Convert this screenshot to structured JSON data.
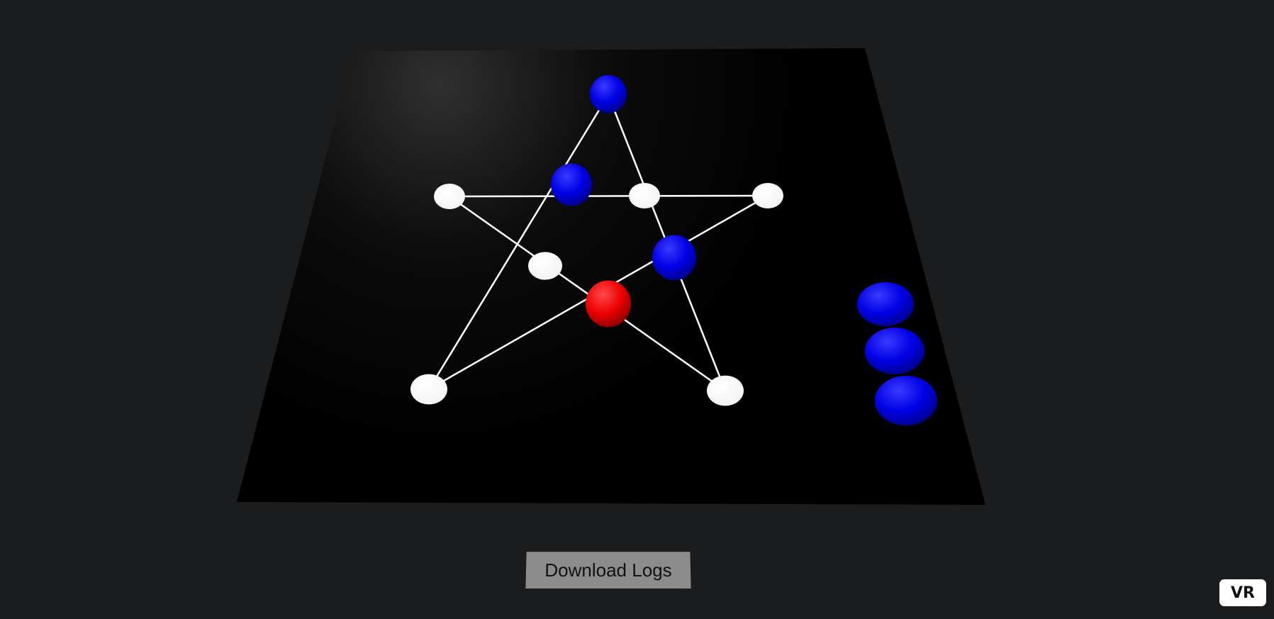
{
  "controls": {
    "download_label": "Download Logs",
    "vr_label": "VR"
  },
  "board": {
    "surface_color": "#000000",
    "line_color": "#ffffff",
    "colors": {
      "empty": "#ffffff",
      "blue": "#0000ee",
      "red": "#ee0000"
    },
    "points": [
      {
        "id": "p1",
        "state": "blue"
      },
      {
        "id": "p2",
        "state": "empty"
      },
      {
        "id": "p3",
        "state": "empty"
      },
      {
        "id": "p4",
        "state": "empty"
      },
      {
        "id": "p5",
        "state": "empty"
      },
      {
        "id": "p6",
        "state": "blue"
      },
      {
        "id": "p7",
        "state": "empty"
      },
      {
        "id": "p8",
        "state": "blue"
      },
      {
        "id": "p9",
        "state": "red"
      },
      {
        "id": "p10",
        "state": "empty"
      }
    ],
    "reserve": [
      {
        "id": "r1",
        "state": "blue"
      },
      {
        "id": "r2",
        "state": "blue"
      },
      {
        "id": "r3",
        "state": "blue"
      }
    ]
  }
}
